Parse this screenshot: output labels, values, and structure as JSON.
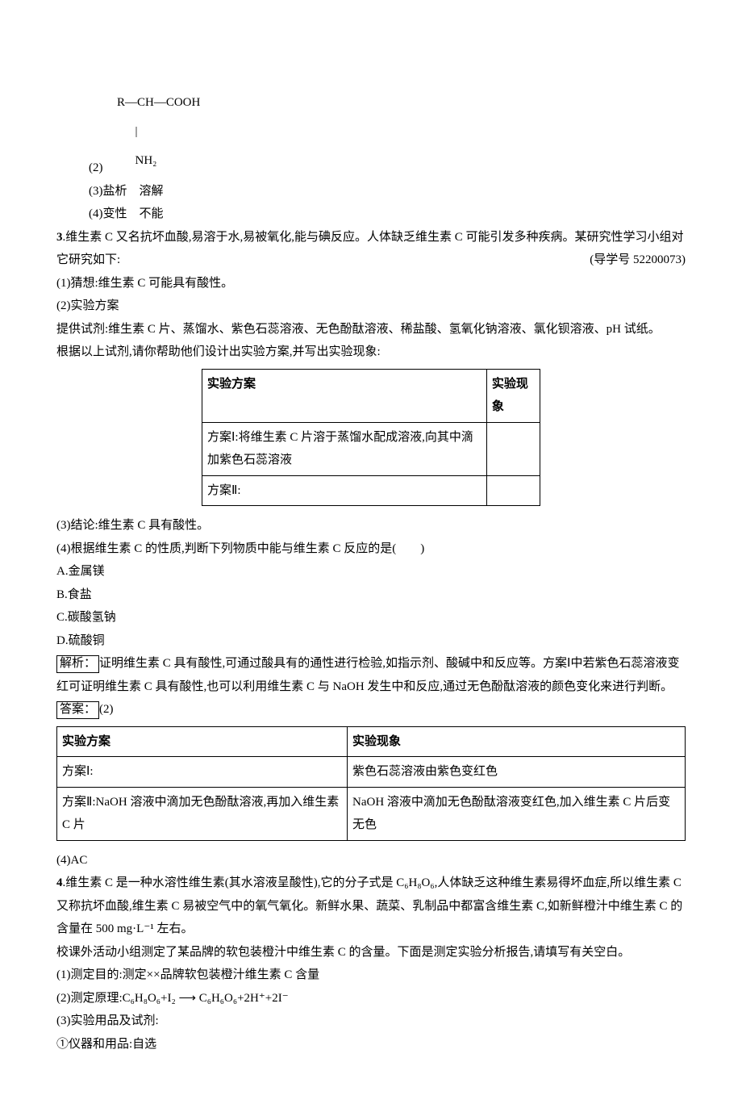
{
  "q2": {
    "formula_line1": "R—CH—COOH",
    "formula_line2": "      |",
    "formula_line3": "      NH₂",
    "label2": "(2)",
    "a3": "(3)盐析　溶解",
    "a4": "(4)变性　不能"
  },
  "q3": {
    "num": "3",
    "intro": ".维生素 C 又名抗坏血酸,易溶于水,易被氧化,能与碘反应。人体缺乏维生素 C 可能引发多种疾病。某研究性学习小组对它研究如下:",
    "ref": "(导学号 52200073)",
    "p1": "(1)猜想:维生素 C 可能具有酸性。",
    "p2": "(2)实验方案",
    "p2b": "提供试剂:维生素 C 片、蒸馏水、紫色石蕊溶液、无色酚酞溶液、稀盐酸、氢氧化钠溶液、氯化钡溶液、pH 试纸。",
    "p2c": "根据以上试剂,请你帮助他们设计出实验方案,并写出实验现象:",
    "t1": {
      "h1": "实验方案",
      "h2": "实验现象",
      "r1": "方案Ⅰ:将维生素 C 片溶于蒸馏水配成溶液,向其中滴加紫色石蕊溶液",
      "r2": "方案Ⅱ:"
    },
    "p3": "(3)结论:维生素 C 具有酸性。",
    "p4": "(4)根据维生素 C 的性质,判断下列物质中能与维生素 C 反应的是(　　)",
    "optA": "A.金属镁",
    "optB": "B.食盐",
    "optC": "C.碳酸氢钠",
    "optD": "D.硫酸铜",
    "jx_label": "解析：",
    "jx": "证明维生素 C 具有酸性,可通过酸具有的通性进行检验,如指示剂、酸碱中和反应等。方案Ⅰ中若紫色石蕊溶液变红可证明维生素 C 具有酸性,也可以利用维生素 C 与 NaOH 发生中和反应,通过无色酚酞溶液的颜色变化来进行判断。",
    "da_label": "答案：",
    "da_prefix": "(2)",
    "t2": {
      "h1": "实验方案",
      "h2": "实验现象",
      "r1a": "方案Ⅰ:",
      "r1b": "紫色石蕊溶液由紫色变红色",
      "r2a": "方案Ⅱ:NaOH 溶液中滴加无色酚酞溶液,再加入维生素 C 片",
      "r2b": "NaOH 溶液中滴加无色酚酞溶液变红色,加入维生素 C 片后变无色"
    },
    "a4": "(4)AC"
  },
  "q4": {
    "num": "4",
    "intro": ".维生素 C 是一种水溶性维生素(其水溶液呈酸性),它的分子式是 C₆H₈O₆,人体缺乏这种维生素易得坏血症,所以维生素 C 又称抗坏血酸,维生素 C 易被空气中的氧气氧化。新鲜水果、蔬菜、乳制品中都富含维生素 C,如新鲜橙汁中维生素 C 的含量在 500 mg·L⁻¹ 左右。",
    "p2": "校课外活动小组测定了某品牌的软包装橙汁中维生素 C 的含量。下面是测定实验分析报告,请填写有关空白。",
    "p1": "(1)测定目的:测定××品牌软包装橙汁维生素 C 含量",
    "p2b_label": "(2)测定原理:",
    "p2b_formula": "C₆H₈O₆+I₂ ⟶ C₆H₆O₆+2H⁺+2I⁻",
    "p3": "(3)实验用品及试剂:",
    "p3a": "①仪器和用品:自选"
  }
}
